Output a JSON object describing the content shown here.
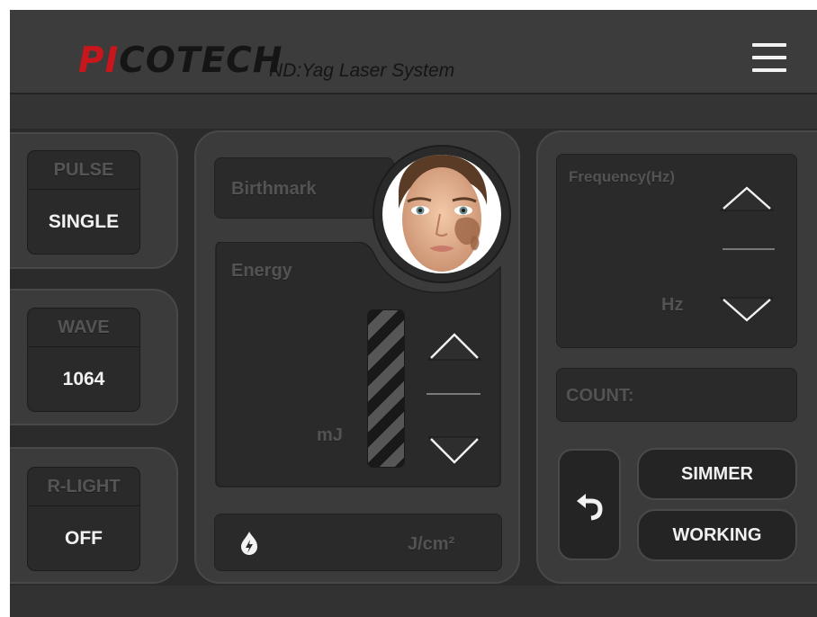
{
  "header": {
    "logo_red": "PI",
    "logo_rest": "COTECH",
    "subtitle": "ND:Yag Laser System",
    "menu_icon": "hamburger-menu-icon"
  },
  "left_settings": [
    {
      "label": "PULSE",
      "value": "SINGLE"
    },
    {
      "label": "WAVE",
      "value": "1064"
    },
    {
      "label": "R-LIGHT",
      "value": "OFF"
    }
  ],
  "treatment": {
    "mode": "Birthmark",
    "energy_label": "Energy",
    "energy_unit": "mJ",
    "fluence_unit": "J/cm²",
    "fluence_icon": "flame-icon"
  },
  "frequency": {
    "label": "Frequency(Hz)",
    "unit": "Hz"
  },
  "count": {
    "label": "COUNT:"
  },
  "actions": {
    "back_icon": "back-arrow-icon",
    "simmer_label": "SIMMER",
    "working_label": "WORKING"
  },
  "colors": {
    "brand_red": "#c8161d",
    "background": "#2b2b2b",
    "panel": "#3b3b3b",
    "button_text": "#f1f1f1",
    "dim_text": "#535353"
  }
}
